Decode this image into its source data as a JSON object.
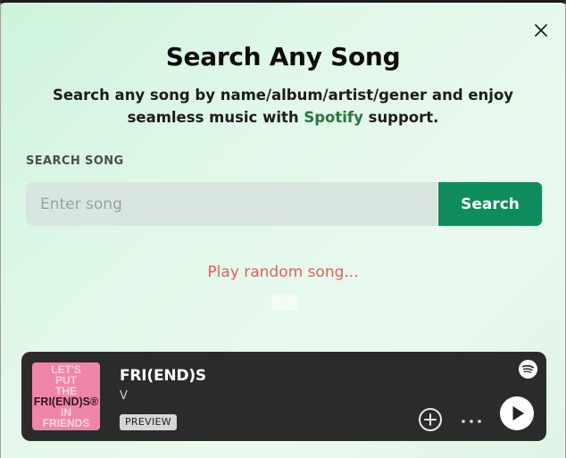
{
  "modal": {
    "title": "Search Any Song",
    "subtitle_part1": "Search any song by name/album/artist/gener and enjoy seamless music with ",
    "subtitle_brand": "Spotify",
    "subtitle_part2": " support.",
    "brand_color": "#23773f"
  },
  "search": {
    "label": "SEARCH SONG",
    "placeholder": "Enter song",
    "value": "",
    "button_label": "Search",
    "button_color": "#0f8c5c"
  },
  "random": {
    "label": "Play random song...",
    "color": "#e85e55"
  },
  "player": {
    "cover_lines": [
      "LET'S",
      "PUT",
      "THE",
      "FRI(END)S®",
      "IN",
      "FRIENDS"
    ],
    "track_title": "FRI(END)S",
    "artist": "V",
    "badge": "PREVIEW",
    "icons": [
      "spotify-icon",
      "add-icon",
      "more-icon",
      "play-icon"
    ]
  }
}
